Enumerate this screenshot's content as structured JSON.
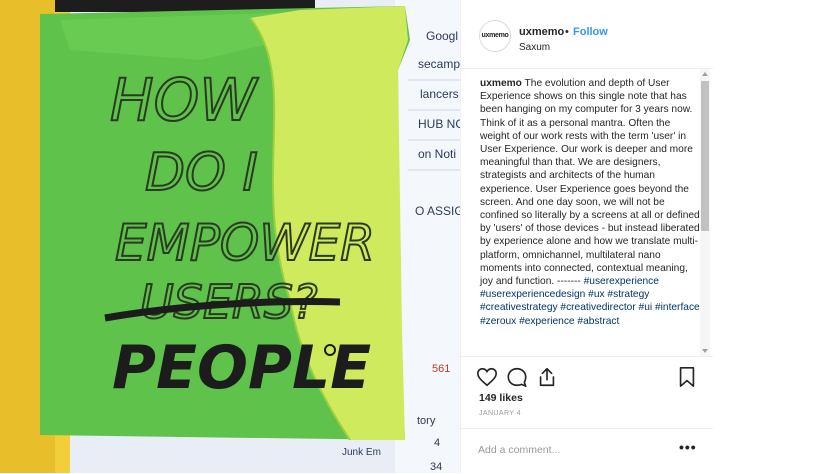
{
  "photo": {
    "screen_texts": [
      "Googl",
      "secamp",
      "lancers",
      "HUB NC",
      "on Noti",
      "O ASSIG",
      "561",
      "tory",
      "Junk Em",
      "4",
      "34"
    ],
    "note_lines": [
      "HOW",
      "DO I",
      "EMPOWER",
      "USERS?",
      "PEOPLE"
    ],
    "colors": {
      "note_green": "#5fc24a",
      "note_yellow": "#cfea5c",
      "wall_yellow": "#f2cf3a",
      "screen": "#e9eef6"
    }
  },
  "post": {
    "username": "uxmemo",
    "separator": "•",
    "follow_label": "Follow",
    "location": "Saxum",
    "avatar_text": "uxmemo",
    "caption_user": "uxmemo",
    "caption_text": " The evolution and depth of User Experience shows on this single note that has been hanging on my computer for 3 years now. Think of it as a personal mantra. Often the weight of our work rests with the term 'user' in User Experience. Our work is deeper and more meaningful than that. We are designers, strategists and architects of the human experience. User Experience goes beyond the screen. And one day soon, we will not be confined so literally by a screens at all or defined by 'users' of those devices - but instead liberated by experience alone and how we translate multi-platform, omnichannel, multilateral nano moments into connected, contextual meaning, joy and function. -------",
    "hashtags": "#userexperience #userexperiencedesign #ux #strategy #creativestrategy #creativedirector #ui #interface #zeroux #experience #abstract",
    "likes": "149 likes",
    "date": "JANUARY 4",
    "comment_placeholder": "Add a comment...",
    "more_label": "•••",
    "link_color": "#3897f0"
  },
  "icons": {
    "like": "heart-icon",
    "comment": "comment-icon",
    "share": "share-icon",
    "save": "bookmark-icon"
  }
}
